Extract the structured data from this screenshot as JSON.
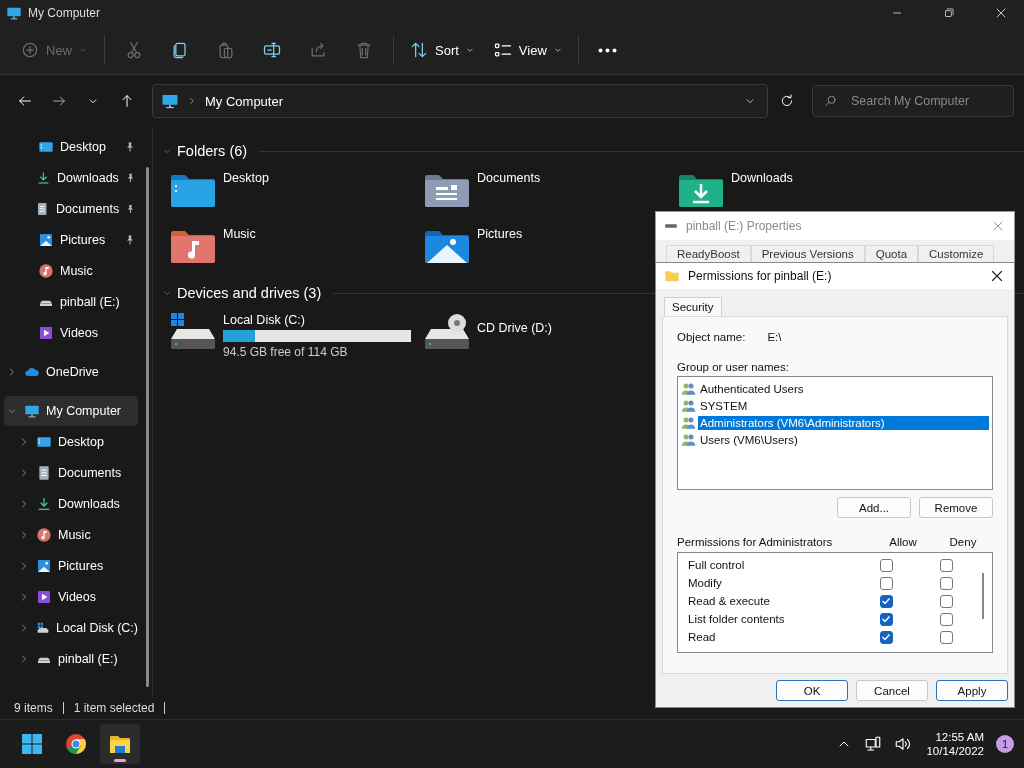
{
  "window": {
    "title": "My Computer"
  },
  "toolbar": {
    "groups": [
      [
        {
          "kind": "new",
          "label": "New",
          "disabled": true
        }
      ],
      [
        {
          "kind": "cut",
          "disabled": true
        },
        {
          "kind": "copy",
          "disabled": false
        },
        {
          "kind": "paste",
          "disabled": true
        },
        {
          "kind": "rename",
          "disabled": false
        },
        {
          "kind": "share",
          "disabled": true
        },
        {
          "kind": "delete",
          "disabled": true
        }
      ],
      [
        {
          "kind": "sort",
          "label": "Sort",
          "disabled": false
        },
        {
          "kind": "view",
          "label": "View",
          "disabled": false
        }
      ],
      [
        {
          "kind": "more",
          "disabled": false
        }
      ]
    ]
  },
  "address": {
    "path": "My Computer"
  },
  "search": {
    "placeholder": "Search My Computer"
  },
  "sidebar": {
    "items": [
      {
        "label": "Desktop",
        "kind": "desktop",
        "pinned": true,
        "selected": false
      },
      {
        "label": "Downloads",
        "kind": "download",
        "pinned": true,
        "selected": false
      },
      {
        "label": "Documents",
        "kind": "document",
        "pinned": true,
        "selected": false
      },
      {
        "label": "Pictures",
        "kind": "picture",
        "pinned": true,
        "selected": false
      },
      {
        "label": "Music",
        "kind": "music",
        "pinned": false,
        "selected": false
      },
      {
        "label": "pinball (E:)",
        "kind": "drive",
        "pinned": false,
        "selected": false
      },
      {
        "label": "Videos",
        "kind": "video",
        "pinned": false,
        "selected": false
      },
      {
        "label": "OneDrive",
        "kind": "cloud",
        "expanded": false,
        "selected": false
      },
      {
        "label": "My Computer",
        "kind": "monitor",
        "expanded": true,
        "selected": true,
        "children": [
          {
            "label": "Desktop",
            "kind": "desktop",
            "expanded": false,
            "selected": false
          },
          {
            "label": "Documents",
            "kind": "document",
            "expanded": false,
            "selected": false
          },
          {
            "label": "Downloads",
            "kind": "download",
            "expanded": false,
            "selected": false
          },
          {
            "label": "Music",
            "kind": "music",
            "expanded": false,
            "selected": false
          },
          {
            "label": "Pictures",
            "kind": "picture",
            "expanded": false,
            "selected": false
          },
          {
            "label": "Videos",
            "kind": "video",
            "expanded": false,
            "selected": false
          },
          {
            "label": "Local Disk (C:)",
            "kind": "disk",
            "expanded": false,
            "selected": false
          },
          {
            "label": "pinball (E:)",
            "kind": "drive",
            "expanded": false,
            "selected": false
          }
        ]
      }
    ]
  },
  "content": {
    "sections": [
      {
        "title": "Folders (6)",
        "expanded": true,
        "items": [
          {
            "label": "Desktop",
            "kind": "f-desktop"
          },
          {
            "label": "Documents",
            "kind": "f-documents"
          },
          {
            "label": "Downloads",
            "kind": "f-downloads"
          },
          {
            "label": "Music",
            "kind": "f-music"
          },
          {
            "label": "Pictures",
            "kind": "f-pictures"
          }
        ]
      },
      {
        "title": "Devices and drives (3)",
        "expanded": true,
        "items": [
          {
            "label": "Local Disk (C:)",
            "kind": "hdd",
            "level": 0.17,
            "detail": "94.5 GB free of 114 GB"
          },
          {
            "label": "CD Drive (D:)",
            "kind": "cd"
          }
        ]
      }
    ]
  },
  "status_bar": {
    "count": "9 items",
    "selection": "1 item selected"
  },
  "properties_dialog": {
    "title": "pinball (E:) Properties",
    "tabs": [
      {
        "label": "ReadyBoost",
        "selected": false
      },
      {
        "label": "Previous Versions",
        "selected": false
      },
      {
        "label": "Quota",
        "selected": false
      },
      {
        "label": "Customize",
        "selected": false
      }
    ]
  },
  "permissions_dialog": {
    "title": "Permissions for pinball (E:)",
    "tabs": [
      {
        "label": "Security",
        "selected": true
      }
    ],
    "object_label": "Object name:",
    "object_value": "E:\\",
    "groups_label": "Group or user names:",
    "groups": [
      {
        "label": "Authenticated Users",
        "selected": false
      },
      {
        "label": "SYSTEM",
        "selected": false
      },
      {
        "label": "Administrators (VM6\\Administrators)",
        "selected": true
      },
      {
        "label": "Users (VM6\\Users)",
        "selected": false
      }
    ],
    "group_buttons": [
      "Add...",
      "Remove"
    ],
    "permissions_label": "Permissions for Administrators",
    "allow_label": "Allow",
    "deny_label": "Deny",
    "permissions": [
      {
        "label": "Full control",
        "allow": false,
        "deny": false
      },
      {
        "label": "Modify",
        "allow": false,
        "deny": false
      },
      {
        "label": "Read & execute",
        "allow": true,
        "deny": false
      },
      {
        "label": "List folder contents",
        "allow": true,
        "deny": false
      },
      {
        "label": "Read",
        "allow": true,
        "deny": false
      }
    ],
    "buttons": [
      "OK",
      "Cancel",
      "Apply"
    ]
  },
  "taskbar": {
    "apps": [
      {
        "kind": "start",
        "selected": false
      },
      {
        "kind": "browser",
        "selected": false
      },
      {
        "kind": "explorer",
        "selected": true
      }
    ],
    "time": "12:55 AM",
    "date": "10/14/2022",
    "notifications": "1"
  }
}
